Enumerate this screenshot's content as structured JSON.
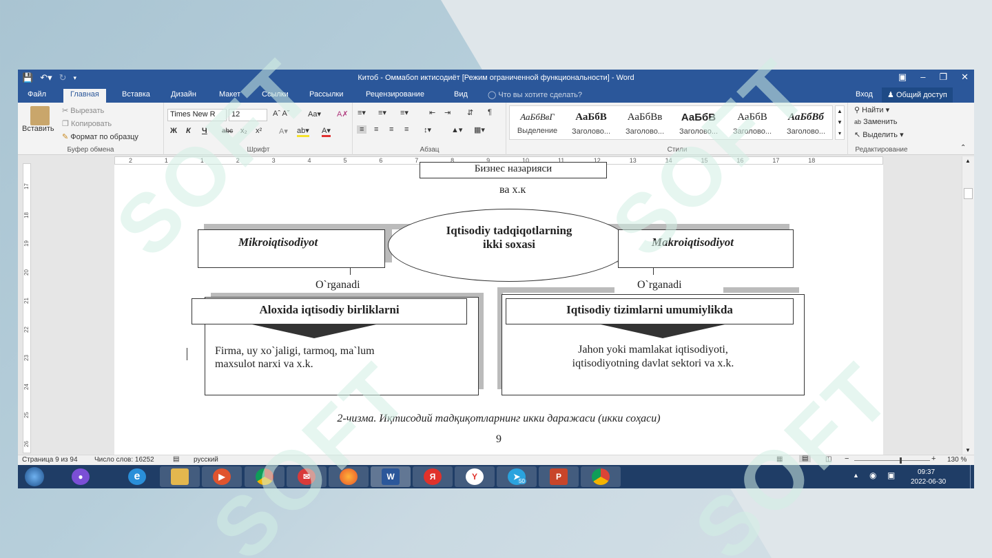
{
  "window": {
    "title": "Китоб - Оммабоп иктисодиёт [Режим ограниченной функциональности] - Word"
  },
  "tabs": [
    "Файл",
    "Главная",
    "Вставка",
    "Дизайн",
    "Макет",
    "Ссылки",
    "Рассылки",
    "Рецензирование",
    "Вид"
  ],
  "tell_me": "Что вы хотите сделать?",
  "account": {
    "login": "Вход",
    "share": "Общий доступ"
  },
  "clipboard": {
    "paste": "Вставить",
    "cut": "Вырезать",
    "copy": "Копировать",
    "format_painter": "Формат по образцу",
    "label": "Буфер обмена"
  },
  "font": {
    "name": "Times New R",
    "size": "12",
    "label": "Шрифт",
    "bold": "Ж",
    "italic": "К",
    "underline": "Ч",
    "strike": "abc",
    "sub": "x₂",
    "sup": "x²"
  },
  "paragraph": {
    "label": "Абзац"
  },
  "styles": {
    "label": "Стили",
    "items": [
      {
        "preview": "АаБбВвГ",
        "name": "Выделение"
      },
      {
        "preview": "АаБбВ",
        "name": "Заголово..."
      },
      {
        "preview": "АаБбВв",
        "name": "Заголово..."
      },
      {
        "preview": "АаБбВ",
        "name": "Заголово..."
      },
      {
        "preview": "АаБбВ",
        "name": "Заголово..."
      },
      {
        "preview": "АаБбВб",
        "name": "Заголово..."
      }
    ]
  },
  "editing": {
    "find": "Найти",
    "replace": "Заменить",
    "select": "Выделить",
    "label": "Редактирование"
  },
  "ruler": {
    "h": [
      "2",
      "1",
      "1",
      "2",
      "3",
      "4",
      "5",
      "6",
      "7",
      "8",
      "9",
      "10",
      "11",
      "12",
      "13",
      "14",
      "15",
      "16",
      "17",
      "18"
    ],
    "v": [
      "17",
      "18",
      "19",
      "20",
      "21",
      "22",
      "23",
      "24",
      "25",
      "26"
    ]
  },
  "document": {
    "top_box": "Бизнес назарияси",
    "top_tail": "ва х.к",
    "center": [
      "Iqtisodiy tadqiqotlarning",
      "ikki soxasi"
    ],
    "left_title": "Mikroiqtisodiyot",
    "right_title": "Makroiqtisodiyot",
    "studies_left": "O`rganadi",
    "studies_right": "O`rganadi",
    "left_head": "Aloxida iqtisodiy birliklarni",
    "right_head": "Iqtisodiy tizimlarni umumiylikda",
    "left_body": [
      "Firma, uy xo`jaligi, tarmoq, ma`lum",
      "maxsulot narxi va x.k."
    ],
    "right_body": [
      "Jahon yoki mamlakat iqtisodiyoti,",
      "iqtisodiyotning davlat sektori va x.k."
    ],
    "caption": "2-чизма. Иқтисодий тадқиқотларнинг икки даражаси (икки соҳаси)",
    "page_number": "9"
  },
  "status": {
    "page": "Страница 9 из 94",
    "words": "Число слов: 16252",
    "language": "русский",
    "zoom": "130 %",
    "zoom_level": 0.6
  },
  "taskbar": {
    "time": "09:37",
    "date": "2022-06-30",
    "telegram_badge": "50"
  },
  "colors": {
    "word_blue": "#2b579a",
    "taskbar": "#1f3d66"
  }
}
